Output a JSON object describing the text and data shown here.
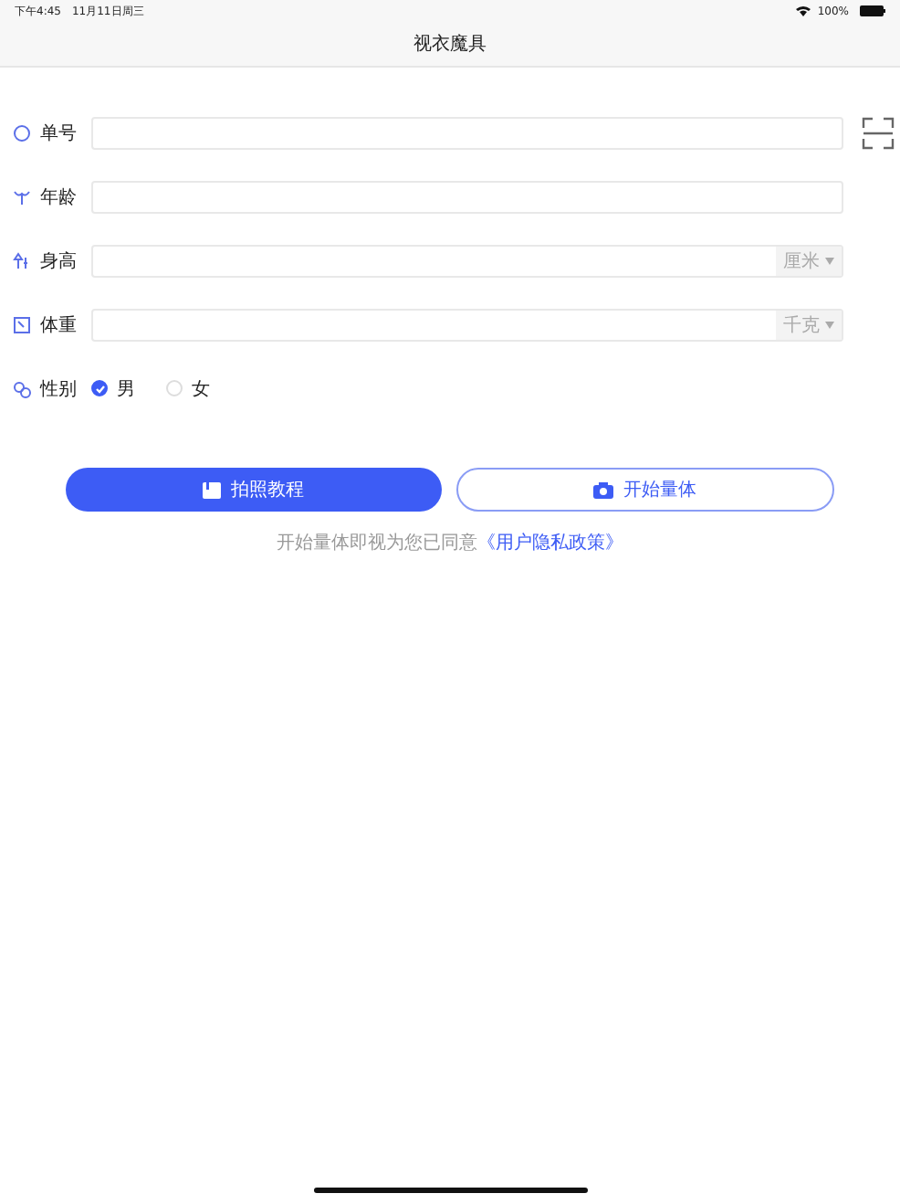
{
  "status_bar": {
    "time": "下午4:45",
    "date": "11月11日周三",
    "battery": "100%"
  },
  "title": "视衣魔具",
  "fields": [
    {
      "kind": "scan",
      "label": "单号"
    },
    {
      "kind": "text",
      "label": "年龄"
    },
    {
      "kind": "unit",
      "label": "身高",
      "unit": "厘米"
    },
    {
      "kind": "unit",
      "label": "体重",
      "unit": "千克"
    }
  ],
  "gender": {
    "label": "性别",
    "options": [
      {
        "label": "男",
        "selected": true
      },
      {
        "label": "女",
        "selected": false
      }
    ]
  },
  "buttons": [
    {
      "kind": "primary",
      "label": "拍照教程"
    },
    {
      "kind": "outline",
      "label": "开始量体"
    }
  ],
  "consent": {
    "text": "开始量体即视为您已同意",
    "link": "《用户隐私政策》"
  }
}
